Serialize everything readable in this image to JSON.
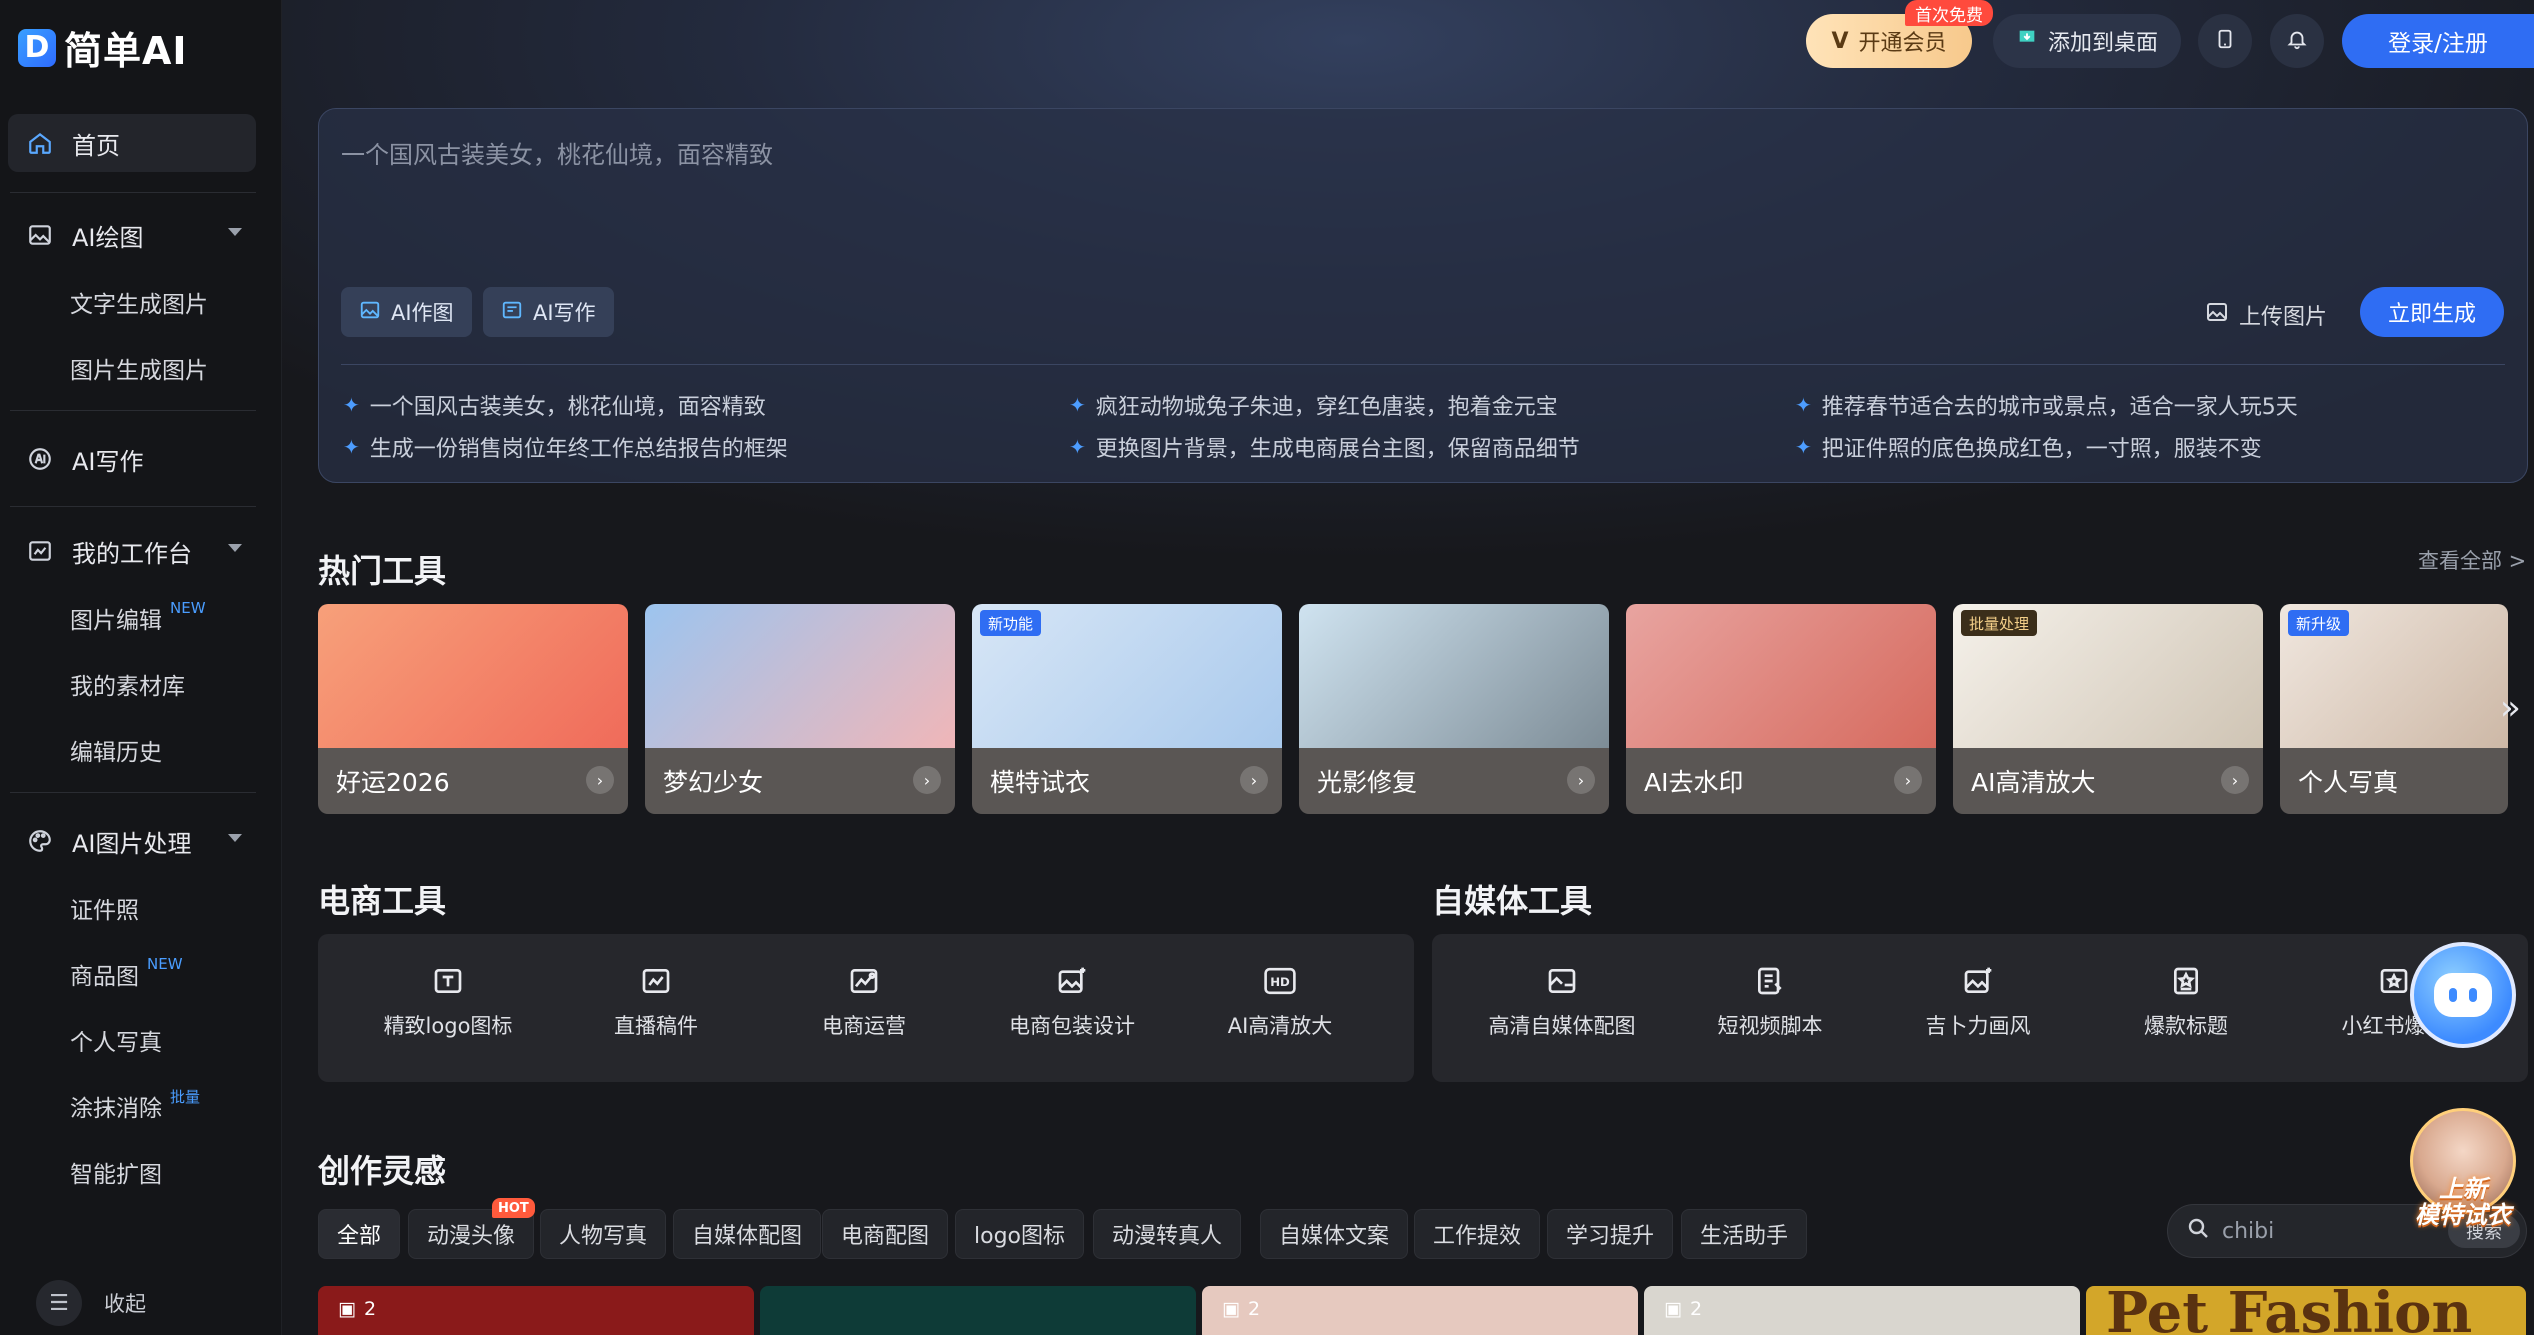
{
  "brand": {
    "logo_letter": "D",
    "name": "简单AI"
  },
  "topbar": {
    "vip_label": "开通会员",
    "vip_badge": "首次免费",
    "desktop_label": "添加到桌面",
    "login_label": "登录/注册"
  },
  "sidebar": {
    "home": "首页",
    "ai_draw": "AI绘图",
    "ai_draw_items": [
      "文字生成图片",
      "图片生成图片"
    ],
    "ai_write": "AI写作",
    "workspace": "我的工作台",
    "workspace_items": [
      {
        "label": "图片编辑",
        "tag": "NEW"
      },
      {
        "label": "我的素材库",
        "tag": ""
      },
      {
        "label": "编辑历史",
        "tag": ""
      }
    ],
    "image_proc": "AI图片处理",
    "image_proc_items": [
      {
        "label": "证件照",
        "tag": ""
      },
      {
        "label": "商品图",
        "tag": "NEW"
      },
      {
        "label": "个人写真",
        "tag": ""
      },
      {
        "label": "涂抹消除",
        "tag": "批量"
      },
      {
        "label": "智能扩图",
        "tag": ""
      }
    ],
    "collapse_label": "收起"
  },
  "prompt": {
    "placeholder": "一个国风古装美女，桃花仙境，面容精致",
    "ai_image_btn": "AI作图",
    "ai_write_btn": "AI写作",
    "upload_label": "上传图片",
    "generate_label": "立即生成",
    "suggestions": [
      "一个国风古装美女，桃花仙境，面容精致",
      "疯狂动物城兔子朱迪，穿红色唐装，抱着金元宝",
      "推荐春节适合去的城市或景点，适合一家人玩5天",
      "生成一份销售岗位年终工作总结报告的框架",
      "更换图片背景，生成电商展台主图，保留商品细节",
      "把证件照的底色换成红色，一寸照，服装不变"
    ]
  },
  "hot_tools": {
    "title": "热门工具",
    "see_all": "查看全部 >",
    "cards": [
      {
        "label": "好运2026",
        "tag": "",
        "colors": [
          "#f7a07a",
          "#f06b5a"
        ]
      },
      {
        "label": "梦幻少女",
        "tag": "",
        "colors": [
          "#9cc4ef",
          "#f0b6b8"
        ]
      },
      {
        "label": "模特试衣",
        "tag": "新功能",
        "colors": [
          "#d7e6f6",
          "#a9c9ec"
        ]
      },
      {
        "label": "光影修复",
        "tag": "",
        "colors": [
          "#cfe3f0",
          "#7d8c96"
        ]
      },
      {
        "label": "AI去水印",
        "tag": "",
        "colors": [
          "#e8a4a0",
          "#d66a5e"
        ]
      },
      {
        "label": "AI高清放大",
        "tag": "批量处理",
        "colors": [
          "#f5f1ea",
          "#cfc4b4"
        ]
      },
      {
        "label": "个人写真",
        "tag": "新升级",
        "colors": [
          "#f0e7df",
          "#cdb8a6"
        ]
      }
    ]
  },
  "ecommerce": {
    "title": "电商工具",
    "tools": [
      "精致logo图标",
      "直播稿件",
      "电商运营",
      "电商包装设计",
      "AI高清放大"
    ]
  },
  "media": {
    "title": "自媒体工具",
    "tools": [
      "高清自媒体配图",
      "短视频脚本",
      "吉卜力画风",
      "爆款标题",
      "小红书爆款"
    ]
  },
  "inspiration": {
    "title": "创作灵感",
    "chips": [
      "全部",
      "动漫头像",
      "人物写真",
      "自媒体配图",
      "电商配图",
      "logo图标",
      "动漫转真人",
      "自媒体文案",
      "工作提效",
      "学习提升",
      "生活助手"
    ],
    "hot_badge": "HOT",
    "search_value": "chibi",
    "search_btn": "搜索",
    "thumbs": [
      {
        "count": "2",
        "color": "#8a1a1a"
      },
      {
        "count": "",
        "color": "#0e3b37"
      },
      {
        "count": "2",
        "color": "#e6c9bf"
      },
      {
        "count": "2",
        "color": "#d9d6cf"
      },
      {
        "count": "",
        "color": "#d3a629",
        "text": "Pet Fashion"
      }
    ]
  },
  "promo": {
    "line1": "上新",
    "line2": "模特试衣"
  }
}
